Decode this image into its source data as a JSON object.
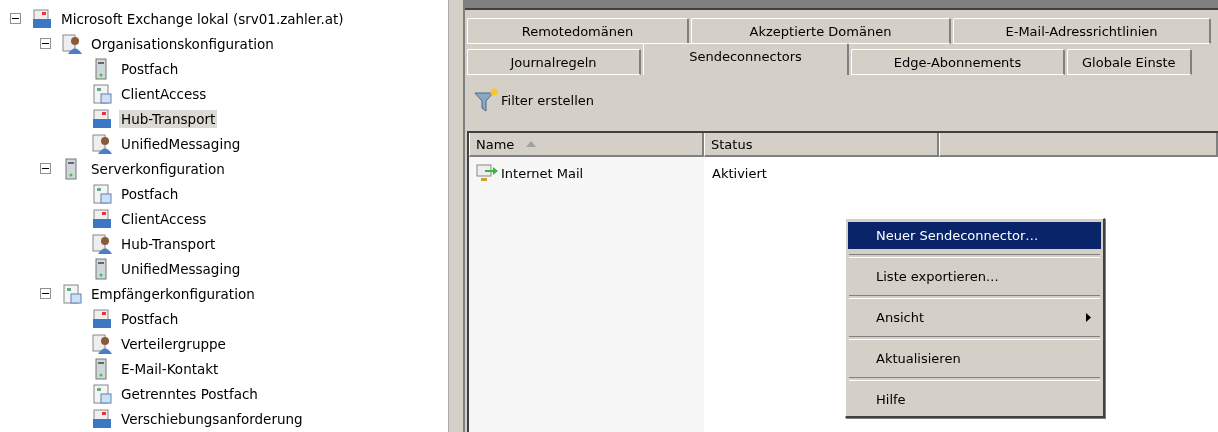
{
  "tree": [
    {
      "label": "Microsoft Exchange lokal (srv01.zahler.at)",
      "expanded": true,
      "selected": false,
      "children": [
        {
          "label": "Organisationskonfiguration",
          "expanded": true,
          "selected": false,
          "children": [
            {
              "label": "Postfach",
              "selected": false
            },
            {
              "label": "ClientAccess",
              "selected": false
            },
            {
              "label": "Hub-Transport",
              "selected": true
            },
            {
              "label": "UnifiedMessaging",
              "selected": false
            }
          ]
        },
        {
          "label": "Serverkonfiguration",
          "expanded": true,
          "selected": false,
          "children": [
            {
              "label": "Postfach",
              "selected": false
            },
            {
              "label": "ClientAccess",
              "selected": false
            },
            {
              "label": "Hub-Transport",
              "selected": false
            },
            {
              "label": "UnifiedMessaging",
              "selected": false
            }
          ]
        },
        {
          "label": "Empfängerkonfiguration",
          "expanded": true,
          "selected": false,
          "children": [
            {
              "label": "Postfach",
              "selected": false
            },
            {
              "label": "Verteilergruppe",
              "selected": false
            },
            {
              "label": "E-Mail-Kontakt",
              "selected": false
            },
            {
              "label": "Getrenntes Postfach",
              "selected": false
            },
            {
              "label": "Verschiebungsanforderung",
              "selected": false
            }
          ]
        }
      ]
    }
  ],
  "tab_rows": [
    [
      {
        "label": "Remotedomänen",
        "selected": false
      },
      {
        "label": "Akzeptierte Domänen",
        "selected": false
      },
      {
        "label": "E-Mail-Adressrichtlinien",
        "selected": false
      }
    ],
    [
      {
        "label": "Journalregeln",
        "selected": false
      },
      {
        "label": "Sendeconnectors",
        "selected": true
      },
      {
        "label": "Edge-Abonnements",
        "selected": false
      },
      {
        "label": "Globale Einste",
        "selected": false
      }
    ]
  ],
  "toolbar": {
    "filter_button": "Filter erstellen"
  },
  "table": {
    "columns": [
      {
        "label": "Name",
        "sorted_ascending": true
      },
      {
        "label": "Status"
      },
      {}
    ],
    "rows": [
      {
        "name": "Internet Mail",
        "status": "Aktiviert"
      }
    ]
  },
  "context_menu": [
    {
      "label": "Neuer Sendeconnector…",
      "selected": true,
      "submenu": false
    },
    {
      "label": "Liste exportieren…",
      "selected": false,
      "submenu": false
    },
    {
      "label": "Ansicht",
      "selected": false,
      "submenu": true
    },
    {
      "label": "Aktualisieren",
      "selected": false,
      "submenu": false
    },
    {
      "label": "Hilfe",
      "selected": false,
      "submenu": false
    }
  ]
}
